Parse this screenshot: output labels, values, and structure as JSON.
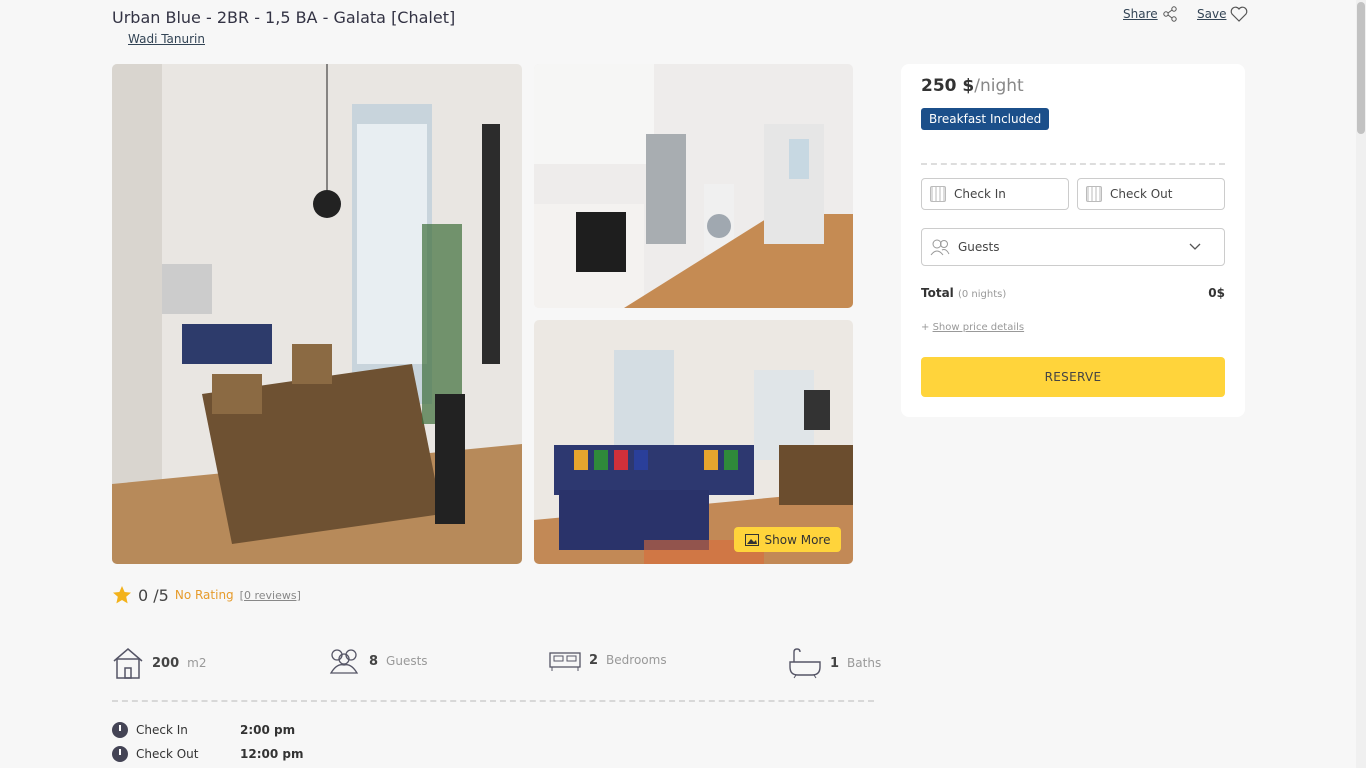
{
  "listing": {
    "title": "Urban Blue - 2BR - 1,5 BA - Galata [Chalet]",
    "host": "Wadi Tanurin"
  },
  "actions": {
    "share": "Share",
    "save": "Save"
  },
  "gallery": {
    "show_more": "Show More"
  },
  "rating": {
    "score": "0 /5",
    "label": "No Rating",
    "reviews": "[0 reviews]"
  },
  "features": [
    {
      "value": "200",
      "unit": "m2",
      "icon": "house-icon"
    },
    {
      "value": "8",
      "unit": "Guests",
      "icon": "guests-icon"
    },
    {
      "value": "2",
      "unit": "Bedrooms",
      "icon": "bed-icon"
    },
    {
      "value": "1",
      "unit": "Baths",
      "icon": "bathtub-icon"
    }
  ],
  "times": [
    {
      "label": "Check In",
      "value": "2:00 pm"
    },
    {
      "label": "Check Out",
      "value": "12:00 pm"
    }
  ],
  "booking": {
    "price": "250 $",
    "per": "/night",
    "badge": "Breakfast Included",
    "check_in": "Check In",
    "check_out": "Check Out",
    "guests": "Guests",
    "total_label": "Total",
    "total_nights": "(0 nights)",
    "total_value": "0$",
    "price_details": "Show price details",
    "reserve": "RESERVE"
  },
  "colors": {
    "accent": "#ffd43b",
    "badge": "#1b4f8a"
  }
}
